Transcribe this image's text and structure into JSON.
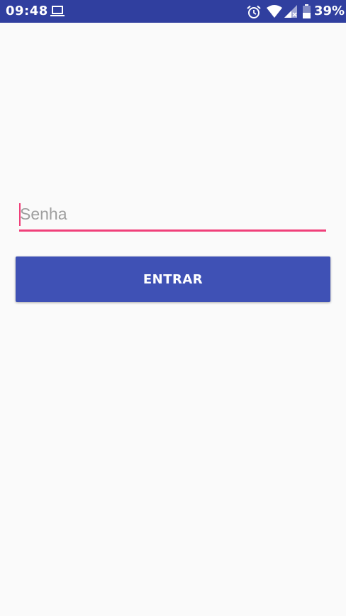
{
  "status_bar": {
    "time": "09:48",
    "battery_percent": "39%",
    "background_color": "#303f9f",
    "icons": [
      "laptop-icon",
      "alarm-icon",
      "wifi-icon",
      "signal-icon",
      "battery-icon"
    ]
  },
  "login": {
    "password_placeholder": "Senha",
    "password_value": "",
    "field_accent_color": "#f0407a",
    "enter_button_label": "ENTRAR",
    "button_color": "#3f51b5"
  }
}
